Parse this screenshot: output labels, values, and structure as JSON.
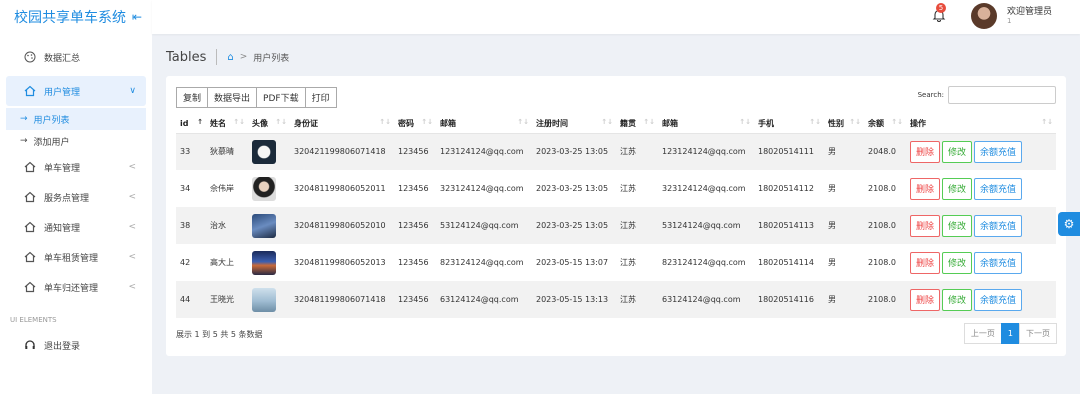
{
  "brand": {
    "title": "校园共享单车系统",
    "collapse": "⇤"
  },
  "sidebar": {
    "items": [
      {
        "label": "数据汇总"
      },
      {
        "label": "用户管理"
      },
      {
        "label": "单车管理"
      },
      {
        "label": "服务点管理"
      },
      {
        "label": "通知管理"
      },
      {
        "label": "单车租赁管理"
      },
      {
        "label": "单车归还管理"
      }
    ],
    "sub_items": [
      {
        "label": "用户列表"
      },
      {
        "label": "添加用户"
      }
    ],
    "section": "UI ELEMENTS",
    "logout": "退出登录"
  },
  "topbar": {
    "bell_count": "5",
    "welcome": "欢迎管理员",
    "welcome_sub": "1"
  },
  "breadcrumb": {
    "title": "Tables",
    "current": "用户列表"
  },
  "toolbar": {
    "copy": "复制",
    "export": "数据导出",
    "pdf": "PDF下载",
    "print": "打印",
    "search_label": "Search:"
  },
  "table": {
    "headers": [
      "id",
      "姓名",
      "头像",
      "身份证",
      "密码",
      "邮箱",
      "注册时间",
      "籍贯",
      "邮箱",
      "手机",
      "性别",
      "余额",
      "操作"
    ],
    "rows": [
      [
        "33",
        "狄慕晴",
        "",
        "320421199806071418",
        "123456",
        "123124124@qq.com",
        "2023-03-25 13:05",
        "江苏",
        "123124124@qq.com",
        "18020514111",
        "男",
        "2048.0"
      ],
      [
        "34",
        "佘伟岸",
        "",
        "320481199806052011",
        "123456",
        "323124124@qq.com",
        "2023-03-25 13:05",
        "江苏",
        "323124124@qq.com",
        "18020514112",
        "男",
        "2108.0"
      ],
      [
        "38",
        "治水",
        "",
        "320481199806052010",
        "123456",
        "53124124@qq.com",
        "2023-03-25 13:05",
        "江苏",
        "53124124@qq.com",
        "18020514113",
        "男",
        "2108.0"
      ],
      [
        "42",
        "高大上",
        "",
        "320481199806052013",
        "123456",
        "823124124@qq.com",
        "2023-05-15 13:07",
        "江苏",
        "823124124@qq.com",
        "18020514114",
        "男",
        "2108.0"
      ],
      [
        "44",
        "王晓光",
        "",
        "320481199806071418",
        "123456",
        "63124124@qq.com",
        "2023-05-15 13:13",
        "江苏",
        "63124124@qq.com",
        "18020514116",
        "男",
        "2108.0"
      ]
    ],
    "actions": {
      "delete": "删除",
      "edit": "修改",
      "charge": "余额充值"
    }
  },
  "footer": {
    "info": "展示 1 到 5 共 5 条数据",
    "prev": "上一页",
    "page": "1",
    "next": "下一页"
  },
  "colors": {
    "accent": "#1f8ce0",
    "danger": "#e44",
    "success": "#3a3"
  }
}
